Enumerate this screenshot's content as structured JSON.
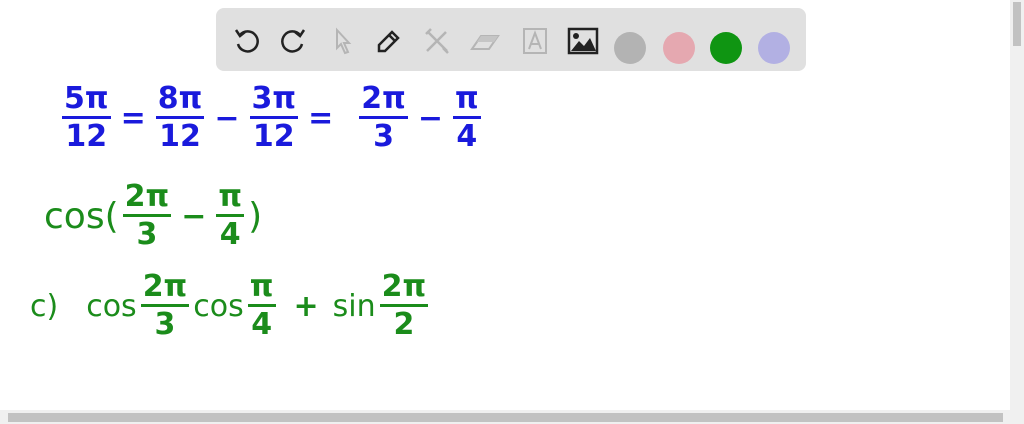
{
  "toolbar": {
    "tools": [
      "undo-icon",
      "redo-icon",
      "select-icon",
      "pen-icon",
      "tools-icon",
      "eraser-icon",
      "text-icon",
      "image-icon"
    ],
    "colors": [
      "#b3b3b3",
      "#e5a8b0",
      "#0f9512",
      "#b2b0e3"
    ]
  },
  "canvas": {
    "line1": {
      "color": "#1a1adc",
      "f1n": "5π",
      "f1d": "12",
      "op1": "=",
      "f2n": "8π",
      "f2d": "12",
      "op2": "−",
      "f3n": "3π",
      "f3d": "12",
      "op3": "=",
      "f4n": "2π",
      "f4d": "3",
      "op4": "−",
      "f5n": "π",
      "f5d": "4"
    },
    "line2": {
      "color": "#1b8c1b",
      "fn": "cos(",
      "f1n": "2π",
      "f1d": "3",
      "op": "−",
      "f2n": "π",
      "f2d": "4",
      "close": ")"
    },
    "line3": {
      "label": "c)",
      "cos1": "cos",
      "f1n": "2π",
      "f1d": "3",
      "cos2": "cos",
      "f2n": "π",
      "f2d": "4",
      "plus": "+",
      "sin": "sin",
      "f3n": "2π",
      "f3d": "2"
    }
  }
}
